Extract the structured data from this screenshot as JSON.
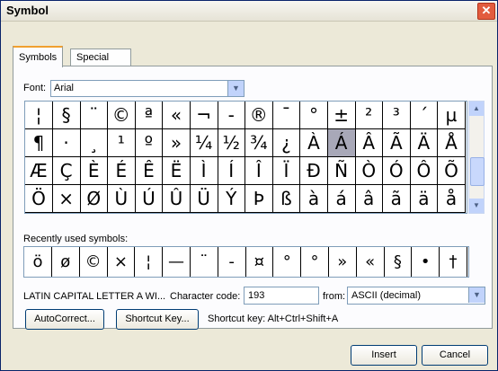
{
  "window": {
    "title": "Symbol",
    "close_glyph": "✕"
  },
  "tabs": [
    {
      "label": "Symbols",
      "active": true
    },
    {
      "label": "Special Characters",
      "active": false
    }
  ],
  "font": {
    "label": "Font:",
    "value": "Arial"
  },
  "symbols": [
    [
      "¦",
      "§",
      "¨",
      "©",
      "ª",
      "«",
      "¬",
      "-",
      "®",
      "¯",
      "°",
      "±",
      "²",
      "³",
      "´",
      "µ"
    ],
    [
      "¶",
      "·",
      "¸",
      "¹",
      "º",
      "»",
      "¼",
      "½",
      "¾",
      "¿",
      "À",
      "Á",
      "Â",
      "Ã",
      "Ä",
      "Å"
    ],
    [
      "Æ",
      "Ç",
      "È",
      "É",
      "Ê",
      "Ë",
      "Ì",
      "Í",
      "Î",
      "Ï",
      "Ð",
      "Ñ",
      "Ò",
      "Ó",
      "Ô",
      "Õ"
    ],
    [
      "Ö",
      "×",
      "Ø",
      "Ù",
      "Ú",
      "Û",
      "Ü",
      "Ý",
      "Þ",
      "ß",
      "à",
      "á",
      "â",
      "ã",
      "ä",
      "å"
    ]
  ],
  "selected": {
    "row": 1,
    "col": 11
  },
  "recent": {
    "label": "Recently used symbols:",
    "items": [
      "ö",
      "ø",
      "©",
      "×",
      "¦",
      "—",
      "¨",
      "-",
      "¤",
      "°",
      "°",
      "»",
      "«",
      "§",
      "•",
      "†"
    ]
  },
  "char_info": {
    "name": "LATIN CAPITAL LETTER A WI...",
    "code_label": "Character code:",
    "code_value": "193",
    "from_label": "from:",
    "from_value": "ASCII (decimal)"
  },
  "buttons": {
    "autocorrect": "AutoCorrect...",
    "shortcut_key": "Shortcut Key...",
    "insert": "Insert",
    "cancel": "Cancel"
  },
  "shortcut_text": "Shortcut key: Alt+Ctrl+Shift+A"
}
